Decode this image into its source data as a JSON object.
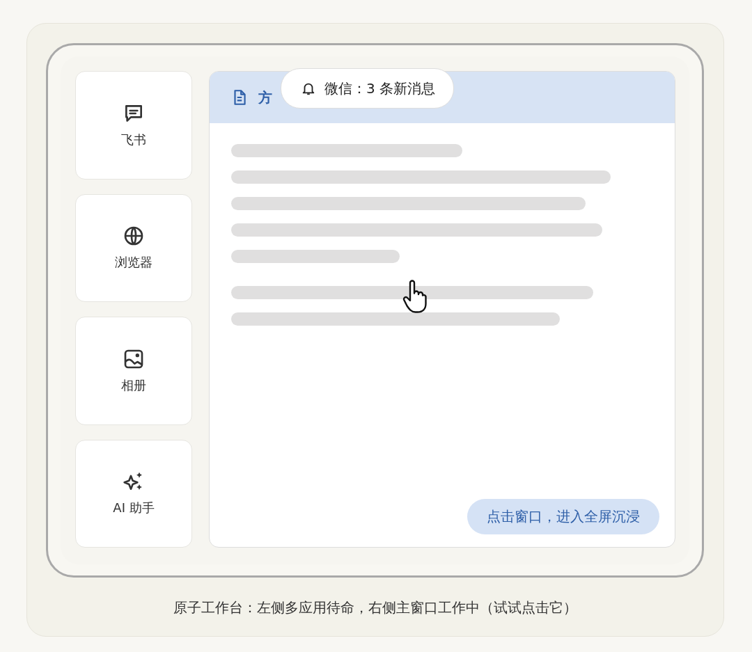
{
  "sidebar": {
    "items": [
      {
        "kind": "chat",
        "label": "飞书"
      },
      {
        "kind": "globe",
        "label": "浏览器"
      },
      {
        "kind": "image",
        "label": "相册"
      },
      {
        "kind": "sparkle",
        "label": "AI 助手"
      }
    ]
  },
  "main_window": {
    "title": "方",
    "action": "点击窗口，进入全屏沉浸"
  },
  "notification": {
    "text": "微信：3 条新消息"
  },
  "caption": "原子工作台：左侧多应用待命，右侧主窗口工作中（试试点击它）"
}
